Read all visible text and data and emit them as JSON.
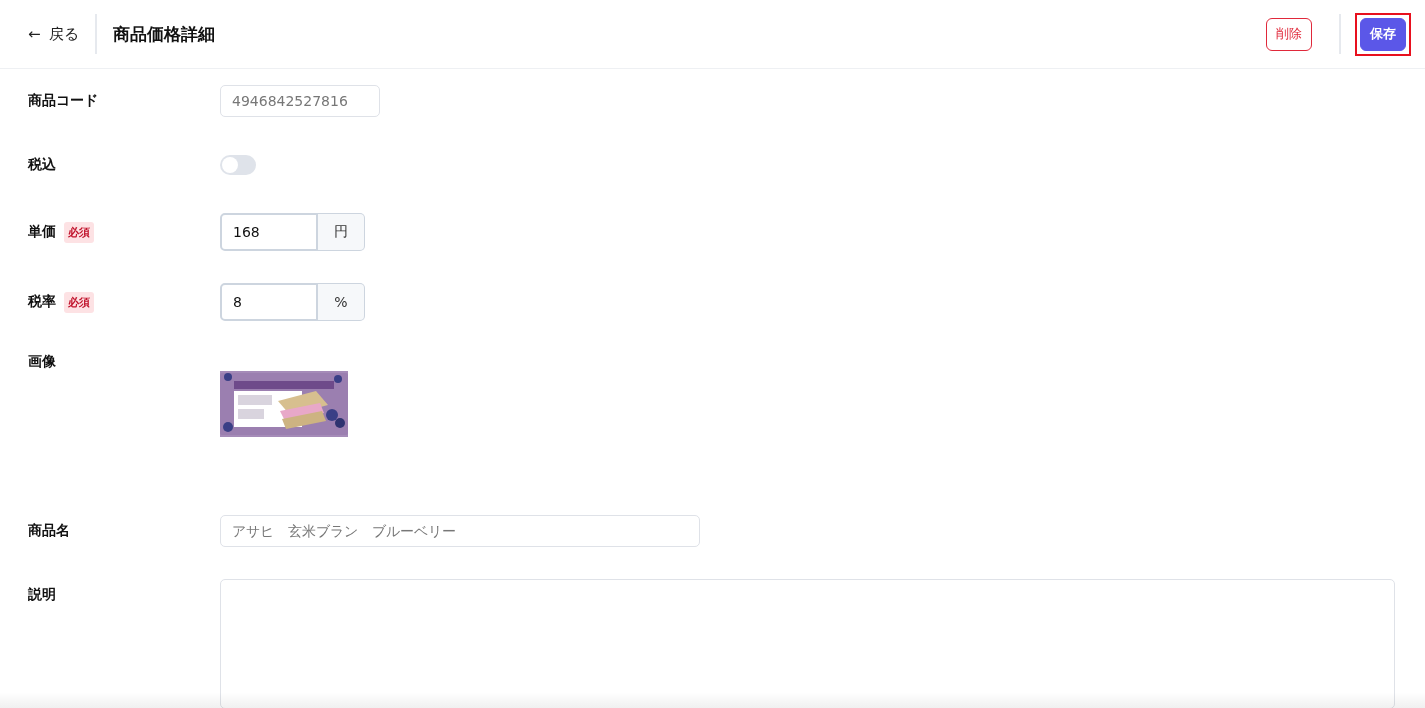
{
  "header": {
    "back": {
      "icon": "←",
      "label": "戻る"
    },
    "title": "商品価格詳細",
    "buttons": [
      {
        "label": "削除",
        "kind": "danger",
        "highlighted": false
      },
      {
        "label": "保存",
        "kind": "primary",
        "highlighted": true
      }
    ]
  },
  "fields": [
    {
      "kind": "text",
      "label": "商品コード",
      "required": false,
      "placeholder": "4946842527816"
    },
    {
      "kind": "toggle",
      "label": "税込",
      "required": false,
      "on": false
    },
    {
      "kind": "unit",
      "label": "単価",
      "required": true,
      "required_label": "必須",
      "value": "168",
      "unit": "円"
    },
    {
      "kind": "unit",
      "label": "税率",
      "required": true,
      "required_label": "必須",
      "value": "8",
      "unit": "%"
    },
    {
      "label": "画像",
      "required": false
    },
    {
      "kind": "wide",
      "label": "商品名",
      "required": false,
      "placeholder": "アサヒ　玄米ブラン　ブルーベリー"
    },
    {
      "kind": "textarea",
      "label": "説明",
      "required": false
    }
  ]
}
